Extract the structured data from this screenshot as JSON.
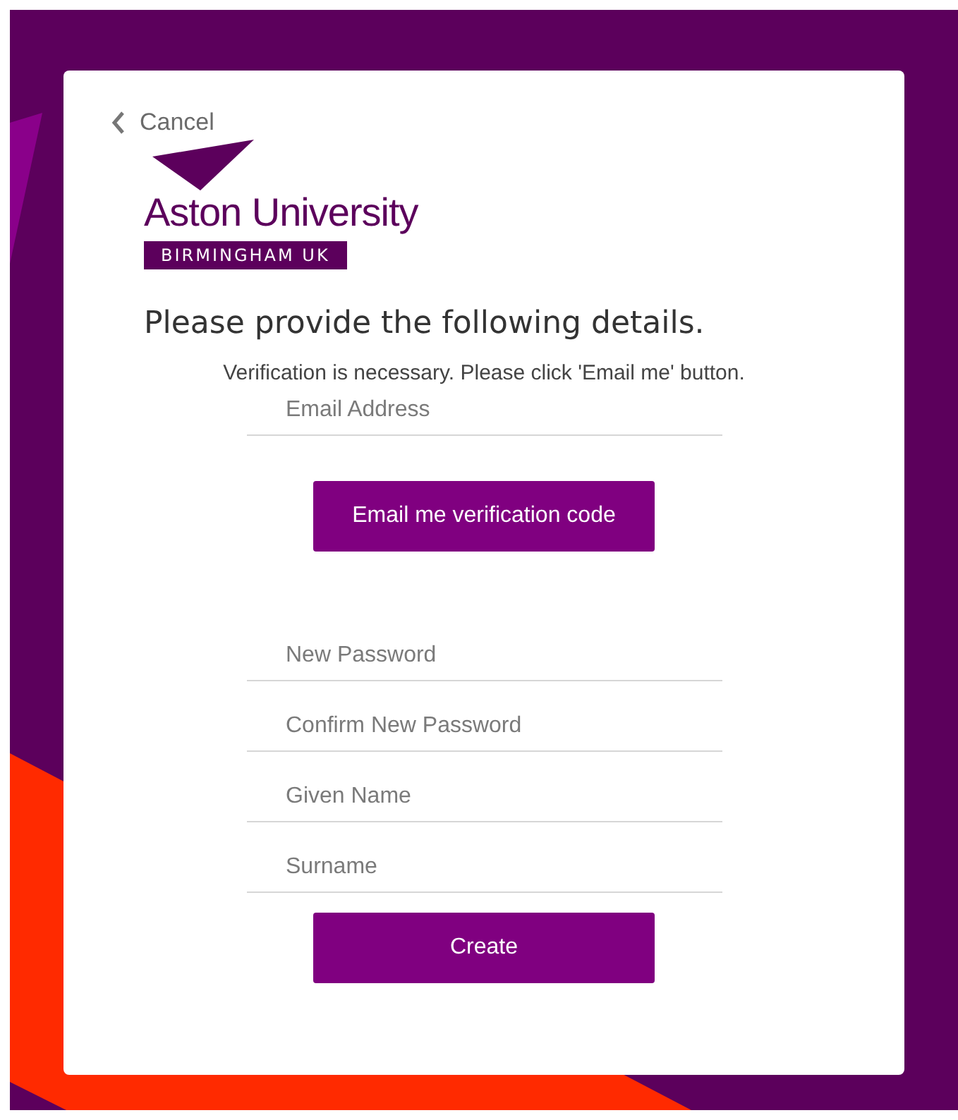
{
  "back_link": {
    "label": "Cancel"
  },
  "logo": {
    "name": "Aston University",
    "tagline": "BIRMINGHAM UK"
  },
  "heading": "Please provide the following details.",
  "notice": "Verification is necessary. Please click 'Email me' button.",
  "form": [
    {
      "kind": "field",
      "placeholder": "Email Address"
    },
    {
      "kind": "button",
      "label": "Email me verification code"
    },
    {
      "kind": "field",
      "placeholder": "New Password"
    },
    {
      "kind": "field",
      "placeholder": "Confirm New Password"
    },
    {
      "kind": "field",
      "placeholder": "Given Name"
    },
    {
      "kind": "field",
      "placeholder": "Surname"
    },
    {
      "kind": "button",
      "label": "Create"
    }
  ]
}
